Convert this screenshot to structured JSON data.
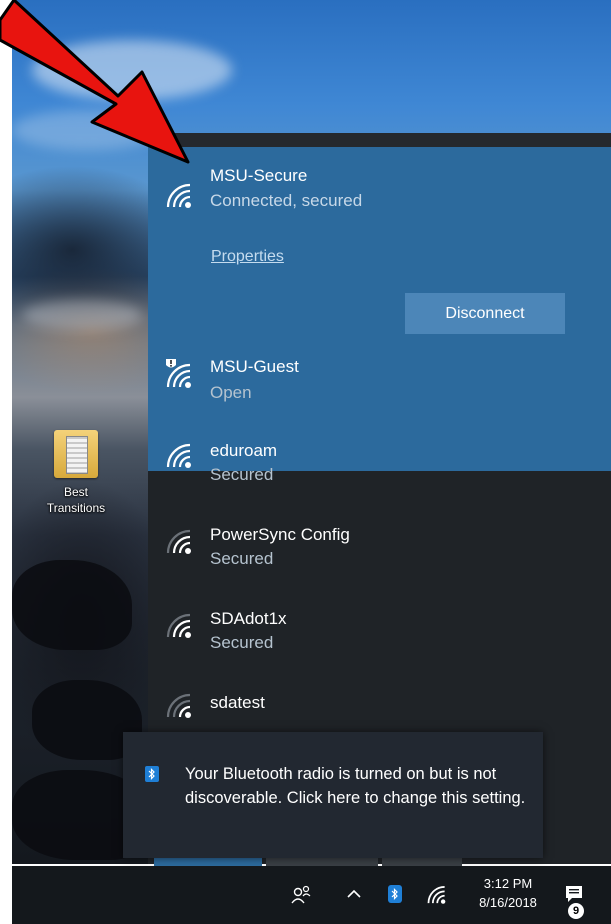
{
  "desktop": {
    "icon_label": "Best Transitions"
  },
  "network_flyout": {
    "connected": {
      "name": "MSU-Secure",
      "status": "Connected, secured",
      "properties_label": "Properties",
      "disconnect_label": "Disconnect",
      "signal_icon": "wifi-signal-icon"
    },
    "networks": [
      {
        "name": "MSU-Guest",
        "status": "Open",
        "icon": "wifi-open-warning-icon"
      },
      {
        "name": "eduroam",
        "status": "Secured",
        "icon": "wifi-signal-icon"
      },
      {
        "name": "PowerSync Config",
        "status": "Secured",
        "icon": "wifi-signal-icon"
      },
      {
        "name": "SDAdot1x",
        "status": "Secured",
        "icon": "wifi-signal-icon"
      },
      {
        "name": "sdatest",
        "status": "",
        "icon": "wifi-signal-icon"
      }
    ]
  },
  "toast": {
    "icon": "bluetooth-icon",
    "message": "Your Bluetooth radio is turned on but is not discoverable.  Click here to change this setting."
  },
  "taskbar": {
    "time": "3:12 PM",
    "date": "8/16/2018",
    "notification_count": "9",
    "icons": [
      "people-icon",
      "chevron-up-icon",
      "bluetooth-icon",
      "wifi-icon",
      "action-center-icon"
    ]
  },
  "colors": {
    "selected_network_bg": "#2c6a9d",
    "flyout_bg": "#1f2327",
    "disconnect_button": "#4c86b8",
    "arrow": "#e8140f",
    "taskbar_bg": "#14181c"
  }
}
